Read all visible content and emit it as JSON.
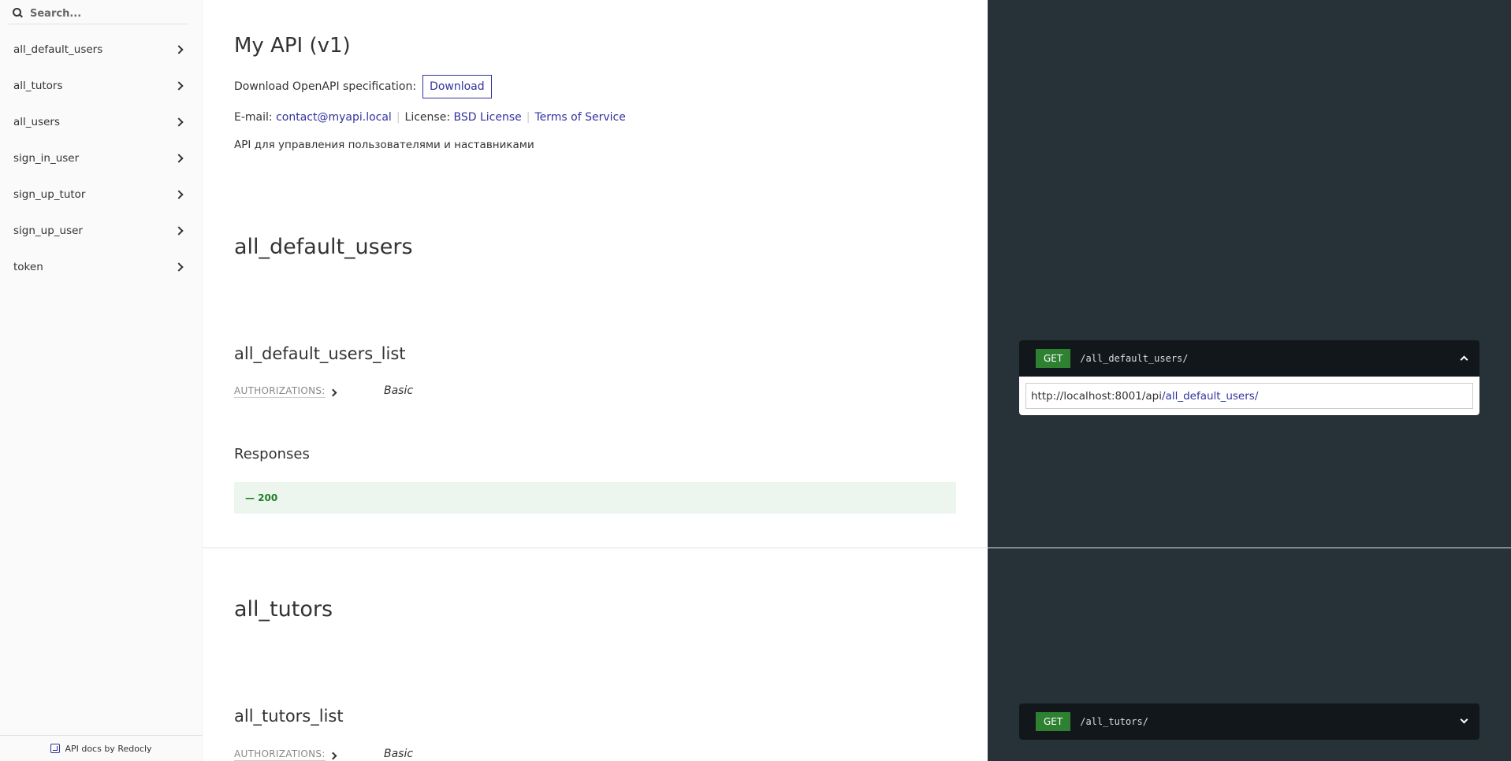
{
  "sidebar": {
    "search_placeholder": "Search...",
    "items": [
      {
        "label": "all_default_users"
      },
      {
        "label": "all_tutors"
      },
      {
        "label": "all_users"
      },
      {
        "label": "sign_in_user"
      },
      {
        "label": "sign_up_tutor"
      },
      {
        "label": "sign_up_user"
      },
      {
        "label": "token"
      }
    ],
    "footer_label": "API docs by Redocly"
  },
  "info": {
    "title": "My API (v1)",
    "download_label": "Download OpenAPI specification:",
    "download_button": "Download",
    "email_label": "E-mail:",
    "email": "contact@myapi.local",
    "license_label": "License:",
    "license": "BSD License",
    "terms": "Terms of Service",
    "description": "API для управления пользователями и наставниками"
  },
  "sections": [
    {
      "title": "all_default_users",
      "operation": "all_default_users_list",
      "auth_label": "AUTHORIZATIONS:",
      "auth_value": "Basic",
      "responses_title": "Responses",
      "response_code": "— 200",
      "endpoint": {
        "method": "GET",
        "path": "/all_default_users/",
        "url_base": "http://localhost:8001/api",
        "url_path": "/all_default_users/",
        "expanded": true
      }
    },
    {
      "title": "all_tutors",
      "operation": "all_tutors_list",
      "auth_label": "AUTHORIZATIONS:",
      "auth_value": "Basic",
      "endpoint": {
        "method": "GET",
        "path": "/all_tutors/",
        "expanded": false
      }
    }
  ],
  "colors": {
    "accent": "#32329f",
    "get": "#2f8132",
    "right_panel": "#263238",
    "response_ok_bg": "#edf6ee",
    "response_ok_text": "#1d8127"
  }
}
